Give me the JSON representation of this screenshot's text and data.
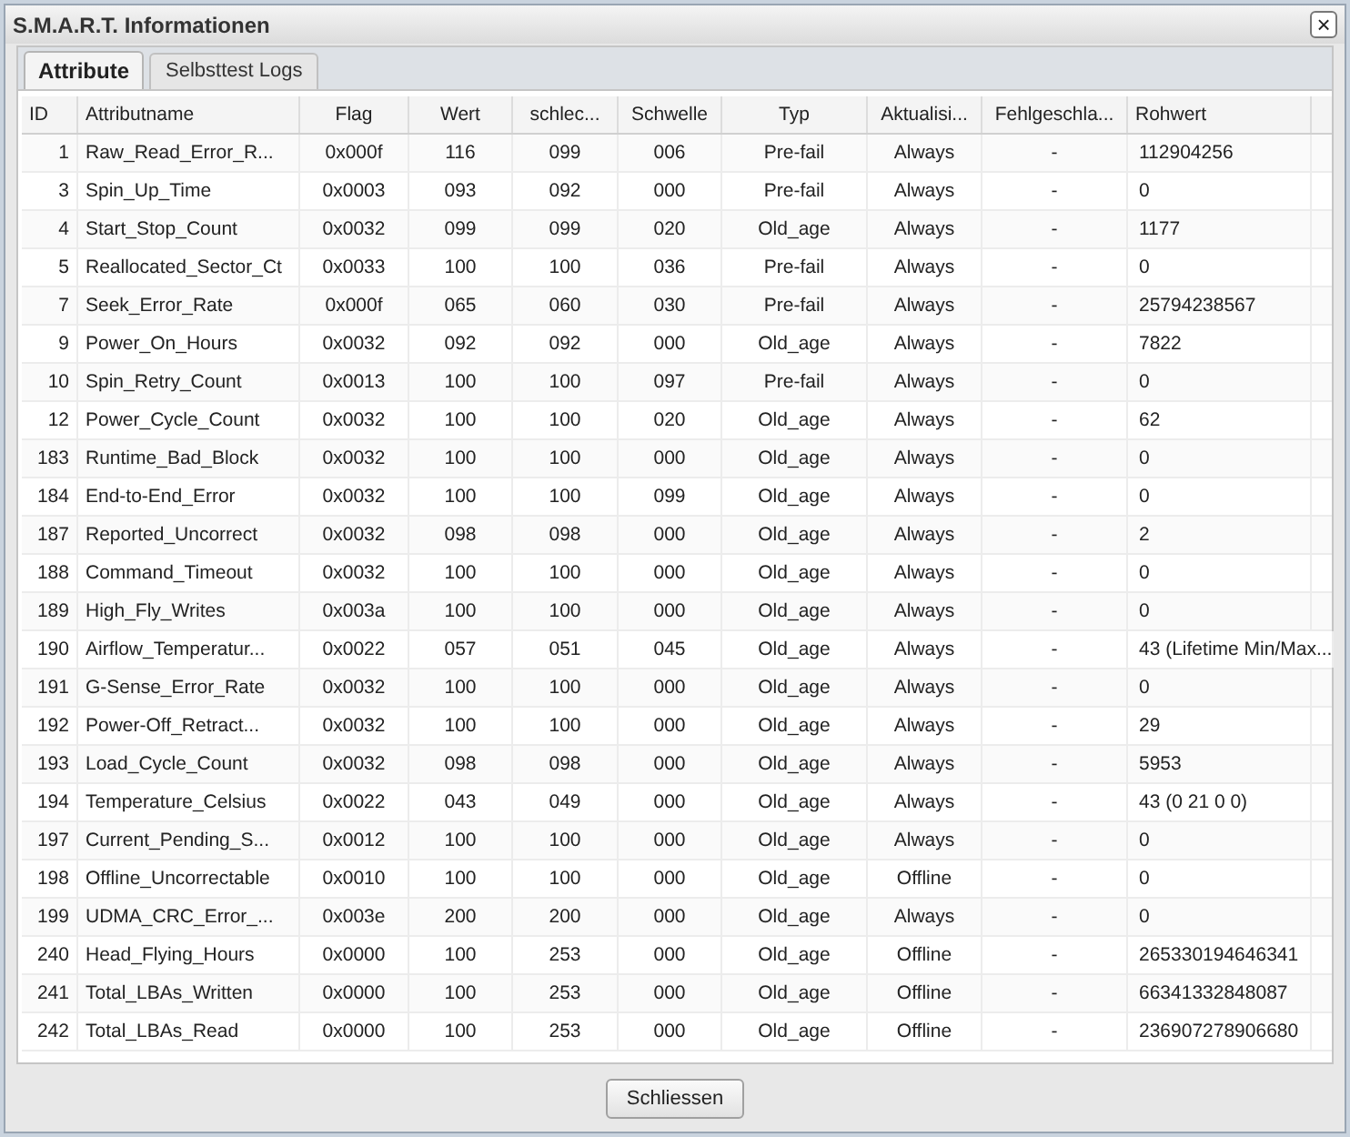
{
  "window": {
    "title": "S.M.A.R.T. Informationen",
    "close": "×"
  },
  "tabs": [
    {
      "label": "Attribute",
      "selected": true
    },
    {
      "label": "Selbsttest Logs",
      "selected": false
    }
  ],
  "table": {
    "columns": [
      {
        "label": "ID"
      },
      {
        "label": "Attributname"
      },
      {
        "label": "Flag"
      },
      {
        "label": "Wert"
      },
      {
        "label": "schlec..."
      },
      {
        "label": "Schwelle"
      },
      {
        "label": "Typ"
      },
      {
        "label": "Aktualisi..."
      },
      {
        "label": "Fehlgeschla..."
      },
      {
        "label": "Rohwert"
      }
    ],
    "rows": [
      [
        "1",
        "Raw_Read_Error_R...",
        "0x000f",
        "116",
        "099",
        "006",
        "Pre-fail",
        "Always",
        "-",
        "112904256"
      ],
      [
        "3",
        "Spin_Up_Time",
        "0x0003",
        "093",
        "092",
        "000",
        "Pre-fail",
        "Always",
        "-",
        "0"
      ],
      [
        "4",
        "Start_Stop_Count",
        "0x0032",
        "099",
        "099",
        "020",
        "Old_age",
        "Always",
        "-",
        "1177"
      ],
      [
        "5",
        "Reallocated_Sector_Ct",
        "0x0033",
        "100",
        "100",
        "036",
        "Pre-fail",
        "Always",
        "-",
        "0"
      ],
      [
        "7",
        "Seek_Error_Rate",
        "0x000f",
        "065",
        "060",
        "030",
        "Pre-fail",
        "Always",
        "-",
        "25794238567"
      ],
      [
        "9",
        "Power_On_Hours",
        "0x0032",
        "092",
        "092",
        "000",
        "Old_age",
        "Always",
        "-",
        "7822"
      ],
      [
        "10",
        "Spin_Retry_Count",
        "0x0013",
        "100",
        "100",
        "097",
        "Pre-fail",
        "Always",
        "-",
        "0"
      ],
      [
        "12",
        "Power_Cycle_Count",
        "0x0032",
        "100",
        "100",
        "020",
        "Old_age",
        "Always",
        "-",
        "62"
      ],
      [
        "183",
        "Runtime_Bad_Block",
        "0x0032",
        "100",
        "100",
        "000",
        "Old_age",
        "Always",
        "-",
        "0"
      ],
      [
        "184",
        "End-to-End_Error",
        "0x0032",
        "100",
        "100",
        "099",
        "Old_age",
        "Always",
        "-",
        "0"
      ],
      [
        "187",
        "Reported_Uncorrect",
        "0x0032",
        "098",
        "098",
        "000",
        "Old_age",
        "Always",
        "-",
        "2"
      ],
      [
        "188",
        "Command_Timeout",
        "0x0032",
        "100",
        "100",
        "000",
        "Old_age",
        "Always",
        "-",
        "0"
      ],
      [
        "189",
        "High_Fly_Writes",
        "0x003a",
        "100",
        "100",
        "000",
        "Old_age",
        "Always",
        "-",
        "0"
      ],
      [
        "190",
        "Airflow_Temperatur...",
        "0x0022",
        "057",
        "051",
        "045",
        "Old_age",
        "Always",
        "-",
        "43 (Lifetime Min/Max..."
      ],
      [
        "191",
        "G-Sense_Error_Rate",
        "0x0032",
        "100",
        "100",
        "000",
        "Old_age",
        "Always",
        "-",
        "0"
      ],
      [
        "192",
        "Power-Off_Retract...",
        "0x0032",
        "100",
        "100",
        "000",
        "Old_age",
        "Always",
        "-",
        "29"
      ],
      [
        "193",
        "Load_Cycle_Count",
        "0x0032",
        "098",
        "098",
        "000",
        "Old_age",
        "Always",
        "-",
        "5953"
      ],
      [
        "194",
        "Temperature_Celsius",
        "0x0022",
        "043",
        "049",
        "000",
        "Old_age",
        "Always",
        "-",
        "43 (0 21 0 0)"
      ],
      [
        "197",
        "Current_Pending_S...",
        "0x0012",
        "100",
        "100",
        "000",
        "Old_age",
        "Always",
        "-",
        "0"
      ],
      [
        "198",
        "Offline_Uncorrectable",
        "0x0010",
        "100",
        "100",
        "000",
        "Old_age",
        "Offline",
        "-",
        "0"
      ],
      [
        "199",
        "UDMA_CRC_Error_...",
        "0x003e",
        "200",
        "200",
        "000",
        "Old_age",
        "Always",
        "-",
        "0"
      ],
      [
        "240",
        "Head_Flying_Hours",
        "0x0000",
        "100",
        "253",
        "000",
        "Old_age",
        "Offline",
        "-",
        "265330194646341"
      ],
      [
        "241",
        "Total_LBAs_Written",
        "0x0000",
        "100",
        "253",
        "000",
        "Old_age",
        "Offline",
        "-",
        "66341332848087"
      ],
      [
        "242",
        "Total_LBAs_Read",
        "0x0000",
        "100",
        "253",
        "000",
        "Old_age",
        "Offline",
        "-",
        "236907278906680"
      ]
    ]
  },
  "buttons": [
    "Schliessen"
  ]
}
